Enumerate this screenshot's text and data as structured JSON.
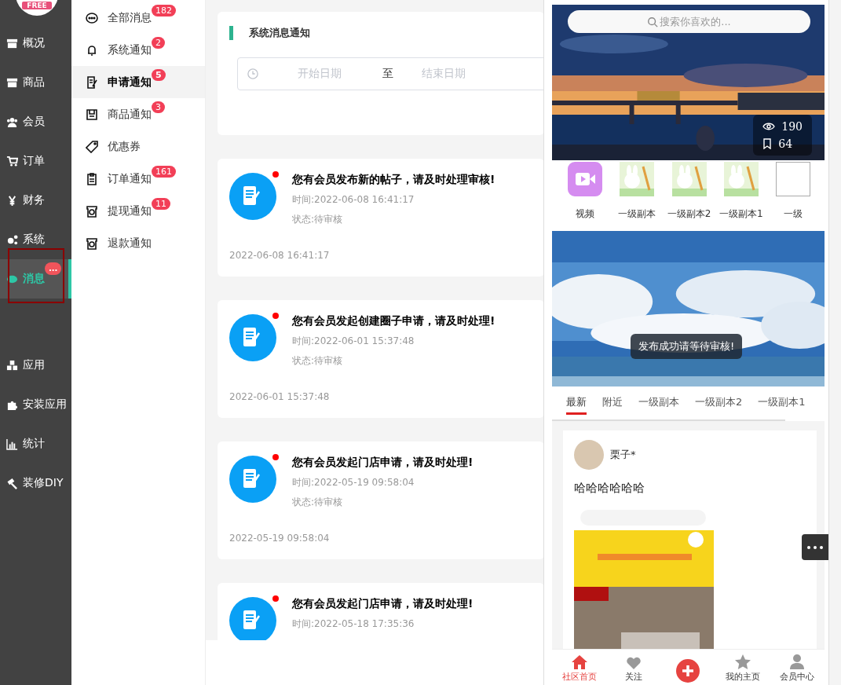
{
  "logo": {
    "badge": "FREE"
  },
  "sidebar": {
    "items": [
      {
        "label": "概况",
        "selected": false
      },
      {
        "label": "商品",
        "selected": false
      },
      {
        "label": "会员",
        "selected": false
      },
      {
        "label": "订单",
        "selected": false
      },
      {
        "label": "财务",
        "selected": false
      },
      {
        "label": "系统",
        "selected": false
      },
      {
        "label": "消息",
        "selected": true,
        "badge": "..."
      }
    ],
    "lower_items": [
      {
        "label": "应用",
        "selected": false
      },
      {
        "label": "安装应用",
        "selected": false
      },
      {
        "label": "统计",
        "selected": false
      },
      {
        "label": "装修DIY",
        "selected": false
      }
    ]
  },
  "submenu": {
    "items": [
      {
        "label": "全部消息",
        "badge": "182",
        "selected": false
      },
      {
        "label": "系统通知",
        "badge": "2",
        "selected": false
      },
      {
        "label": "申请通知",
        "badge": "5",
        "selected": true
      },
      {
        "label": "商品通知",
        "badge": "3",
        "selected": false
      },
      {
        "label": "优惠券",
        "selected": false
      },
      {
        "label": "订单通知",
        "badge": "161",
        "selected": false
      },
      {
        "label": "提现通知",
        "badge": "11",
        "selected": false
      },
      {
        "label": "退款通知",
        "selected": false
      }
    ]
  },
  "filter": {
    "title": "系统消息通知",
    "start_placeholder": "开始日期",
    "separator": "至",
    "end_placeholder": "结束日期"
  },
  "notifications": [
    {
      "title": "您有会员发布新的帖子，请及时处理审核!",
      "time": "时间:2022-06-08 16:41:17",
      "status": "状态:待审核",
      "date": "2022-06-08 16:41:17",
      "unread": true
    },
    {
      "title": "您有会员发起创建圈子申请，请及时处理!",
      "time": "时间:2022-06-01 15:37:48",
      "status": "状态:待审核",
      "date": "2022-06-01 15:37:48",
      "unread": true
    },
    {
      "title": "您有会员发起门店申请，请及时处理!",
      "time": "时间:2022-05-19 09:58:04",
      "status": "状态:待审核",
      "date": "2022-05-19 09:58:04",
      "unread": true
    },
    {
      "title": "您有会员发起门店申请，请及时处理!",
      "time": "时间:2022-05-18 17:35:36",
      "unread": true
    }
  ],
  "phone": {
    "search": {
      "placeholder": "搜索你喜欢的..."
    },
    "banner_stats": {
      "views": "190",
      "saves": "64"
    },
    "shortcuts": [
      {
        "label": "视频",
        "kind": "video"
      },
      {
        "label": "一级副本",
        "kind": "picture"
      },
      {
        "label": "一级副本2",
        "kind": "picture"
      },
      {
        "label": "一级副本1",
        "kind": "picture"
      },
      {
        "label": "一级",
        "kind": "empty"
      }
    ],
    "toast": "发布成功请等待审核!",
    "tabs": [
      {
        "label": "最新",
        "selected": true
      },
      {
        "label": "附近",
        "selected": false
      },
      {
        "label": "一级副本",
        "selected": false
      },
      {
        "label": "一级副本2",
        "selected": false
      },
      {
        "label": "一级副本1",
        "selected": false
      }
    ],
    "post": {
      "author": "栗子*",
      "text": "哈哈哈哈哈哈"
    },
    "nav": [
      {
        "label": "社区首页",
        "kind": "home",
        "selected": true
      },
      {
        "label": "关注",
        "kind": "heart",
        "selected": false
      },
      {
        "kind": "add",
        "selected": false
      },
      {
        "label": "我的主页",
        "kind": "star",
        "selected": false
      },
      {
        "label": "会员中心",
        "kind": "person",
        "selected": false
      }
    ]
  }
}
